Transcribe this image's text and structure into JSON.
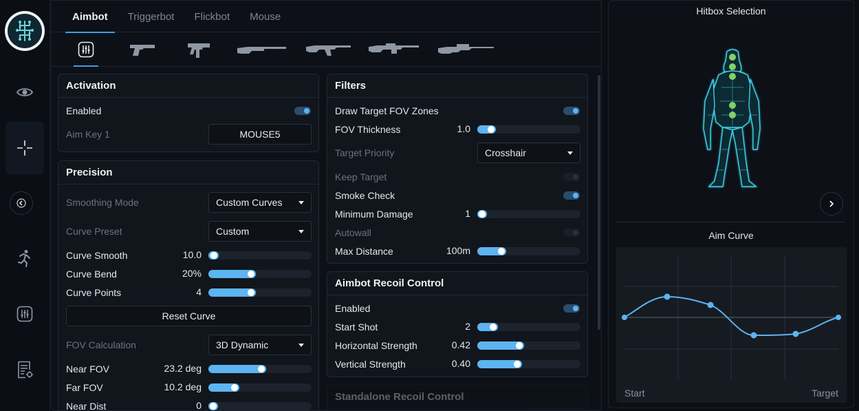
{
  "tabs": [
    "Aimbot",
    "Triggerbot",
    "Flickbot",
    "Mouse"
  ],
  "weapons": [
    "settings-icon",
    "pistol-icon",
    "smg-icon",
    "shotgun-icon",
    "rifle-icon",
    "lmg-icon",
    "sniper-icon"
  ],
  "activation": {
    "title": "Activation",
    "enabled_label": "Enabled",
    "enabled": true,
    "aim_key_label": "Aim Key 1",
    "aim_key_value": "MOUSE5"
  },
  "precision": {
    "title": "Precision",
    "smoothing_mode_label": "Smoothing Mode",
    "smoothing_mode_value": "Custom Curves",
    "curve_preset_label": "Curve Preset",
    "curve_preset_value": "Custom",
    "curve_smooth_label": "Curve Smooth",
    "curve_smooth_value": "10.0",
    "curve_smooth_fraction": 0.1,
    "curve_bend_label": "Curve Bend",
    "curve_bend_value": "20%",
    "curve_bend_fraction": 0.46,
    "curve_points_label": "Curve Points",
    "curve_points_value": "4",
    "curve_points_fraction": 0.46,
    "reset_label": "Reset Curve",
    "fov_calc_label": "FOV Calculation",
    "fov_calc_value": "3D Dynamic",
    "near_fov_label": "Near FOV",
    "near_fov_value": "23.2 deg",
    "near_fov_fraction": 0.56,
    "far_fov_label": "Far FOV",
    "far_fov_value": "10.2 deg",
    "far_fov_fraction": 0.3,
    "near_dist_label": "Near Dist",
    "near_dist_value": "0"
  },
  "filters": {
    "title": "Filters",
    "draw_fov_label": "Draw Target FOV Zones",
    "draw_fov": true,
    "fov_thickness_label": "FOV Thickness",
    "fov_thickness_value": "1.0",
    "fov_thickness_fraction": 0.18,
    "target_priority_label": "Target Priority",
    "target_priority_value": "Crosshair",
    "keep_target_label": "Keep Target",
    "keep_target": false,
    "smoke_check_label": "Smoke Check",
    "smoke_check": true,
    "min_damage_label": "Minimum Damage",
    "min_damage_value": "1",
    "min_damage_fraction": 0.08,
    "autowall_label": "Autowall",
    "autowall": false,
    "max_distance_label": "Max Distance",
    "max_distance_value": "100m",
    "max_distance_fraction": 0.28
  },
  "recoil": {
    "title": "Aimbot Recoil Control",
    "enabled_label": "Enabled",
    "enabled": true,
    "start_shot_label": "Start Shot",
    "start_shot_value": "2",
    "start_shot_fraction": 0.2,
    "horizontal_label": "Horizontal Strength",
    "horizontal_value": "0.42",
    "horizontal_fraction": 0.45,
    "vertical_label": "Vertical Strength",
    "vertical_value": "0.40",
    "vertical_fraction": 0.43
  },
  "standalone": {
    "title": "Standalone Recoil Control"
  },
  "hitbox": {
    "title": "Hitbox Selection"
  },
  "aim_curve": {
    "title": "Aim Curve",
    "start_label": "Start",
    "target_label": "Target"
  },
  "colors": {
    "accent": "#5cb4f1",
    "hitbox_on": "#7fd16a",
    "figure": "#3fd0e8"
  }
}
